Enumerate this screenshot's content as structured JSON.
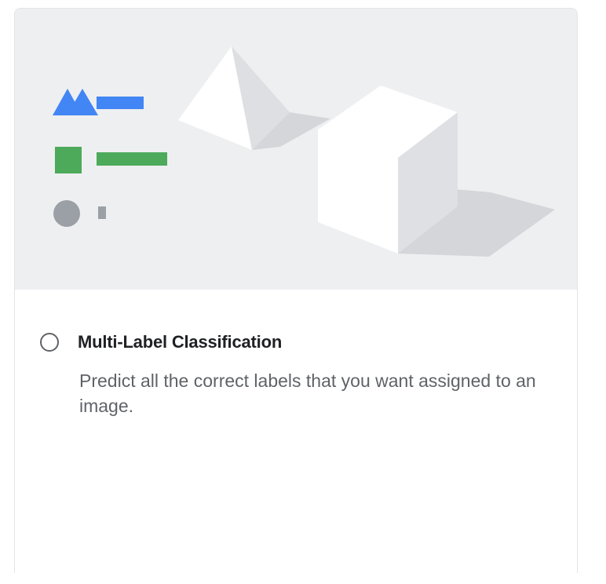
{
  "option": {
    "label": "Multi-Label Classification",
    "description": "Predict all the correct labels that you want assigned to an image.",
    "selected": false
  },
  "illustration": {
    "icons": [
      "triangle-icon",
      "square-icon",
      "circle-icon",
      "pyramid-icon",
      "cube-icon"
    ],
    "colors": {
      "blue": "#4285f4",
      "green": "#4caa5a",
      "gray": "#9aa0a6"
    }
  }
}
